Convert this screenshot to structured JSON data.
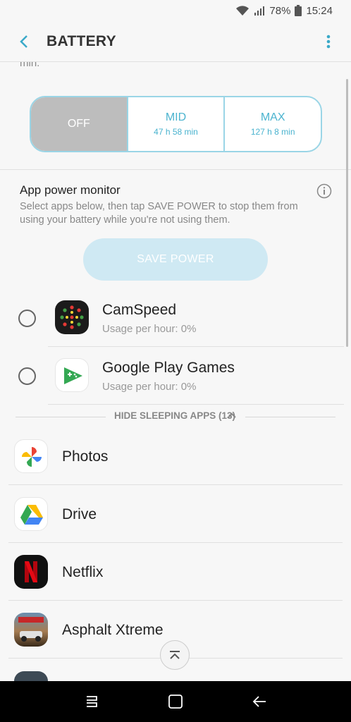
{
  "status": {
    "battery_pct": "78%",
    "time": "15:24"
  },
  "header": {
    "title": "BATTERY"
  },
  "cut_text": "min.",
  "modes": [
    {
      "label": "OFF",
      "sub": ""
    },
    {
      "label": "MID",
      "sub": "47 h 58 min"
    },
    {
      "label": "MAX",
      "sub": "127 h 8 min"
    }
  ],
  "app_power_monitor": {
    "title": "App power monitor",
    "description": "Select apps below, then tap SAVE POWER to stop them from using your battery while you're not using them.",
    "save_button": "SAVE POWER"
  },
  "selectable_apps": [
    {
      "name": "CamSpeed",
      "usage": "Usage per hour: 0%"
    },
    {
      "name": "Google Play Games",
      "usage": "Usage per hour: 0%"
    }
  ],
  "sleeping_toggle": "HIDE SLEEPING APPS (13)",
  "sleeping_apps": [
    {
      "name": "Photos"
    },
    {
      "name": "Drive"
    },
    {
      "name": "Netflix"
    },
    {
      "name": "Asphalt Xtreme"
    }
  ],
  "colors": {
    "accent": "#4ab3cf",
    "selected_mode": "#bdbdbd",
    "save_button_disabled": "#cfe9f3",
    "netflix_red": "#e50914"
  }
}
